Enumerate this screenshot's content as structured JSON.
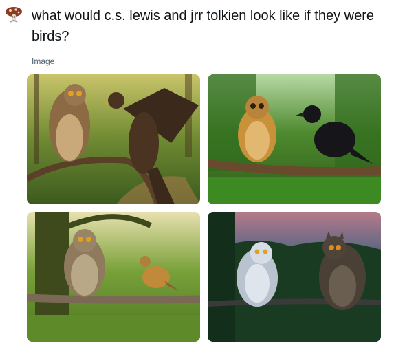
{
  "user": {
    "avatar_icon": "mushroom-avatar-icon"
  },
  "post": {
    "prompt_text": "what would c.s. lewis and jrr tolkien look like if they were birds?",
    "media_label": "Image"
  },
  "images": [
    {
      "icon": "image-owl-and-hawk"
    },
    {
      "icon": "image-owl-and-raven"
    },
    {
      "icon": "image-owl-and-robin"
    },
    {
      "icon": "image-snowy-owl-and-eagle-owl"
    }
  ],
  "colors": {
    "text": "#0f1419",
    "secondary": "#536471",
    "background": "#ffffff"
  }
}
